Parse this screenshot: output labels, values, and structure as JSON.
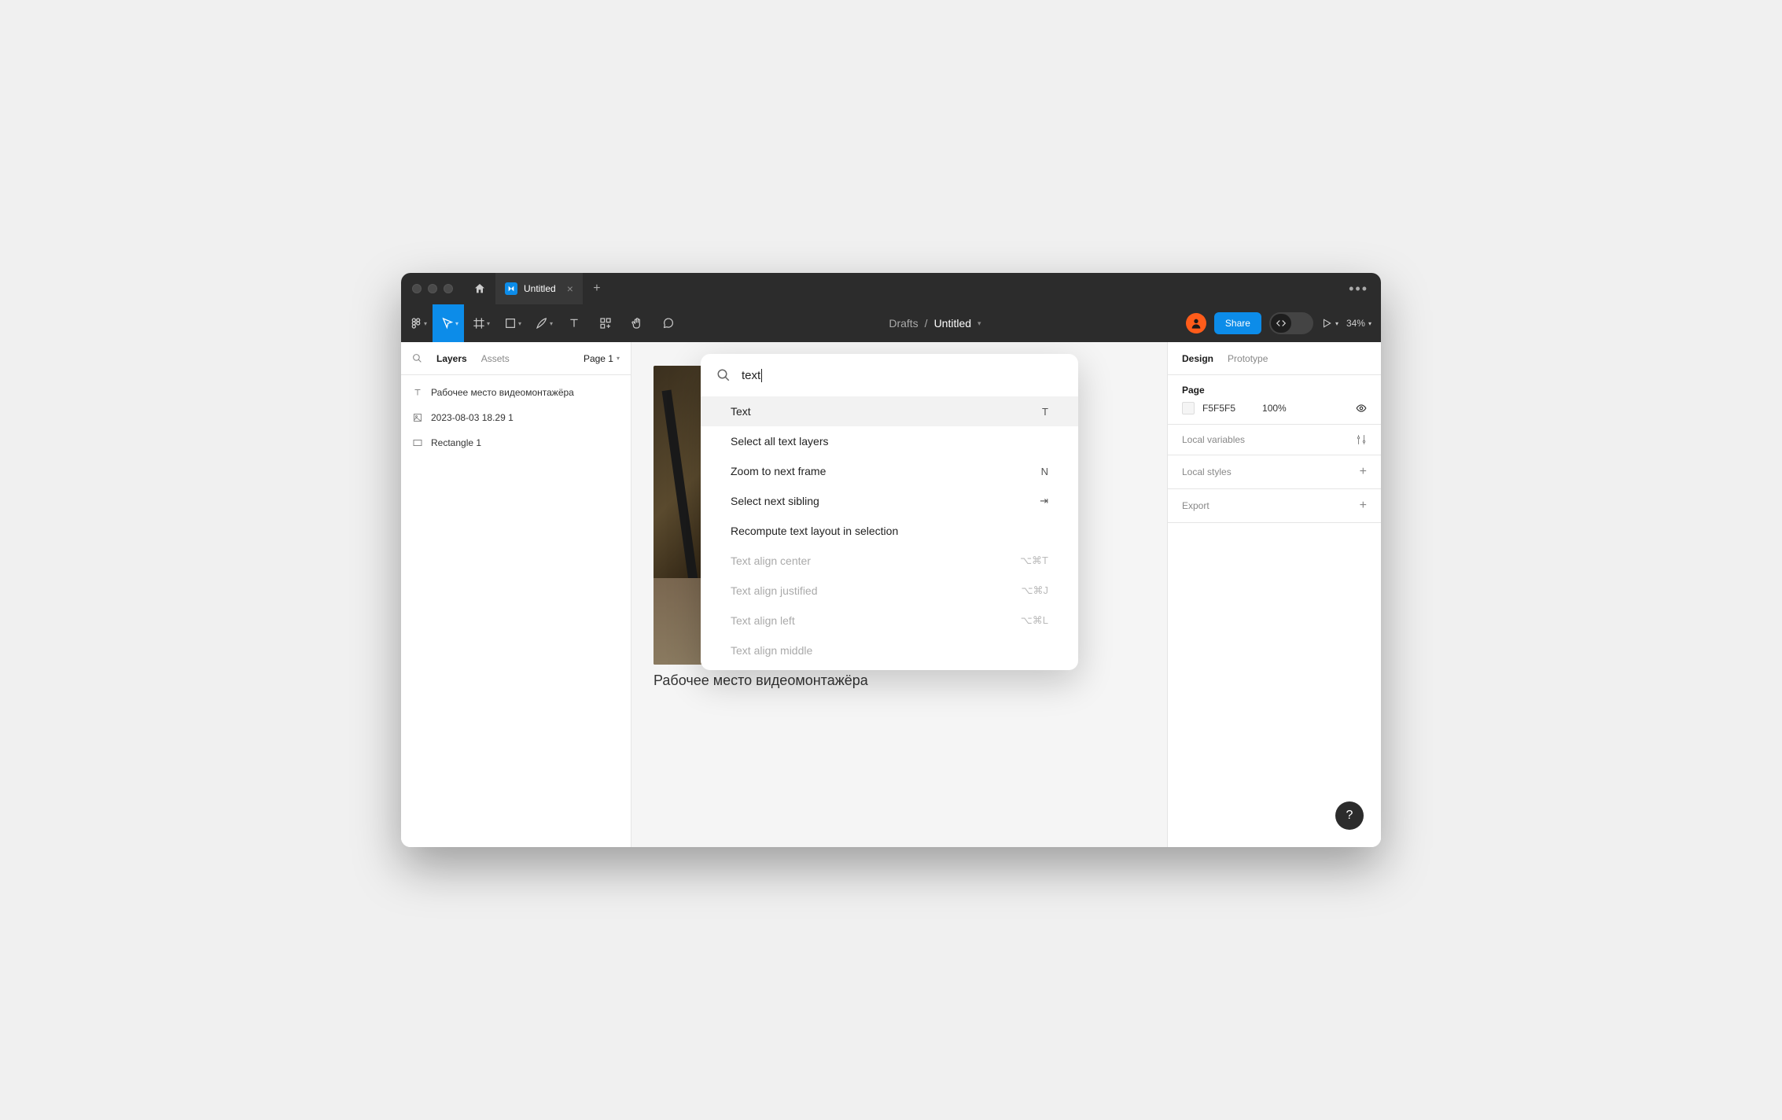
{
  "tab": {
    "title": "Untitled"
  },
  "toolbar": {
    "breadcrumb_parent": "Drafts",
    "breadcrumb_current": "Untitled",
    "share_label": "Share",
    "zoom": "34%"
  },
  "left_panel": {
    "tabs": {
      "layers": "Layers",
      "assets": "Assets"
    },
    "page_selector": "Page 1",
    "layers": [
      {
        "type": "text",
        "name": "Рабочее место видеомонтажёра"
      },
      {
        "type": "image",
        "name": "2023-08-03 18.29 1"
      },
      {
        "type": "rect",
        "name": "Rectangle 1"
      }
    ]
  },
  "canvas": {
    "caption": "Рабочее место видеомонтажёра"
  },
  "command_palette": {
    "query": "text",
    "items": [
      {
        "label": "Text",
        "shortcut": "T",
        "highlighted": true,
        "disabled": false
      },
      {
        "label": "Select all text layers",
        "shortcut": "",
        "highlighted": false,
        "disabled": false
      },
      {
        "label": "Zoom to next frame",
        "shortcut": "N",
        "highlighted": false,
        "disabled": false
      },
      {
        "label": "Select next sibling",
        "shortcut": "⇥",
        "highlighted": false,
        "disabled": false
      },
      {
        "label": "Recompute text layout in selection",
        "shortcut": "",
        "highlighted": false,
        "disabled": false
      },
      {
        "label": "Text align center",
        "shortcut": "⌥⌘T",
        "highlighted": false,
        "disabled": true
      },
      {
        "label": "Text align justified",
        "shortcut": "⌥⌘J",
        "highlighted": false,
        "disabled": true
      },
      {
        "label": "Text align left",
        "shortcut": "⌥⌘L",
        "highlighted": false,
        "disabled": true
      },
      {
        "label": "Text align middle",
        "shortcut": "",
        "highlighted": false,
        "disabled": true
      }
    ]
  },
  "right_panel": {
    "tabs": {
      "design": "Design",
      "prototype": "Prototype"
    },
    "page": {
      "header": "Page",
      "bg_hex": "F5F5F5",
      "bg_opacity": "100%"
    },
    "local_variables_label": "Local variables",
    "local_styles_label": "Local styles",
    "export_label": "Export"
  },
  "help": "?"
}
